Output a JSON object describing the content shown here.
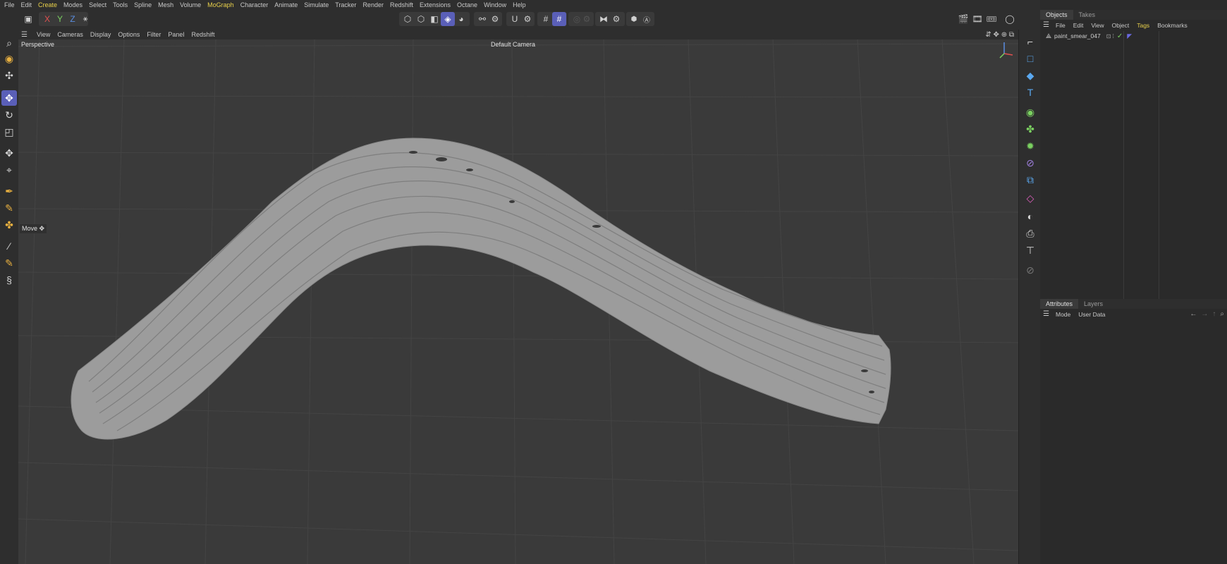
{
  "menubar": {
    "items": [
      "File",
      "Edit",
      "Create",
      "Modes",
      "Select",
      "Tools",
      "Spline",
      "Mesh",
      "Volume",
      "MoGraph",
      "Character",
      "Animate",
      "Simulate",
      "Tracker",
      "Render",
      "Redshift",
      "Extensions",
      "Octane",
      "Window",
      "Help"
    ],
    "accent_items": [
      "Create",
      "MoGraph"
    ]
  },
  "toolbar": {
    "axis_x": "X",
    "axis_y": "Y",
    "axis_z": "Z"
  },
  "viewport": {
    "menu": [
      "View",
      "Cameras",
      "Display",
      "Options",
      "Filter",
      "Panel",
      "Redshift"
    ],
    "view_label": "Perspective",
    "camera_label": "Default Camera",
    "tooltip": "Move",
    "object_color": "#9c9c9c",
    "background_color": "#3a3a3a"
  },
  "objects_panel": {
    "tabs": [
      "Objects",
      "Takes"
    ],
    "menu": [
      "File",
      "Edit",
      "View",
      "Object",
      "Tags",
      "Bookmarks"
    ],
    "accent_menu": "Tags",
    "object_name": "paint_smear_047"
  },
  "attributes_panel": {
    "tabs": [
      "Attributes",
      "Layers"
    ],
    "menu": [
      "Mode",
      "User Data"
    ]
  },
  "colors": {
    "accent_blue": "#5a5fb8",
    "accent_yellow": "#e8d04a",
    "axis_x": "#e05050",
    "axis_y": "#7ad060",
    "axis_z": "#5a8de0"
  }
}
